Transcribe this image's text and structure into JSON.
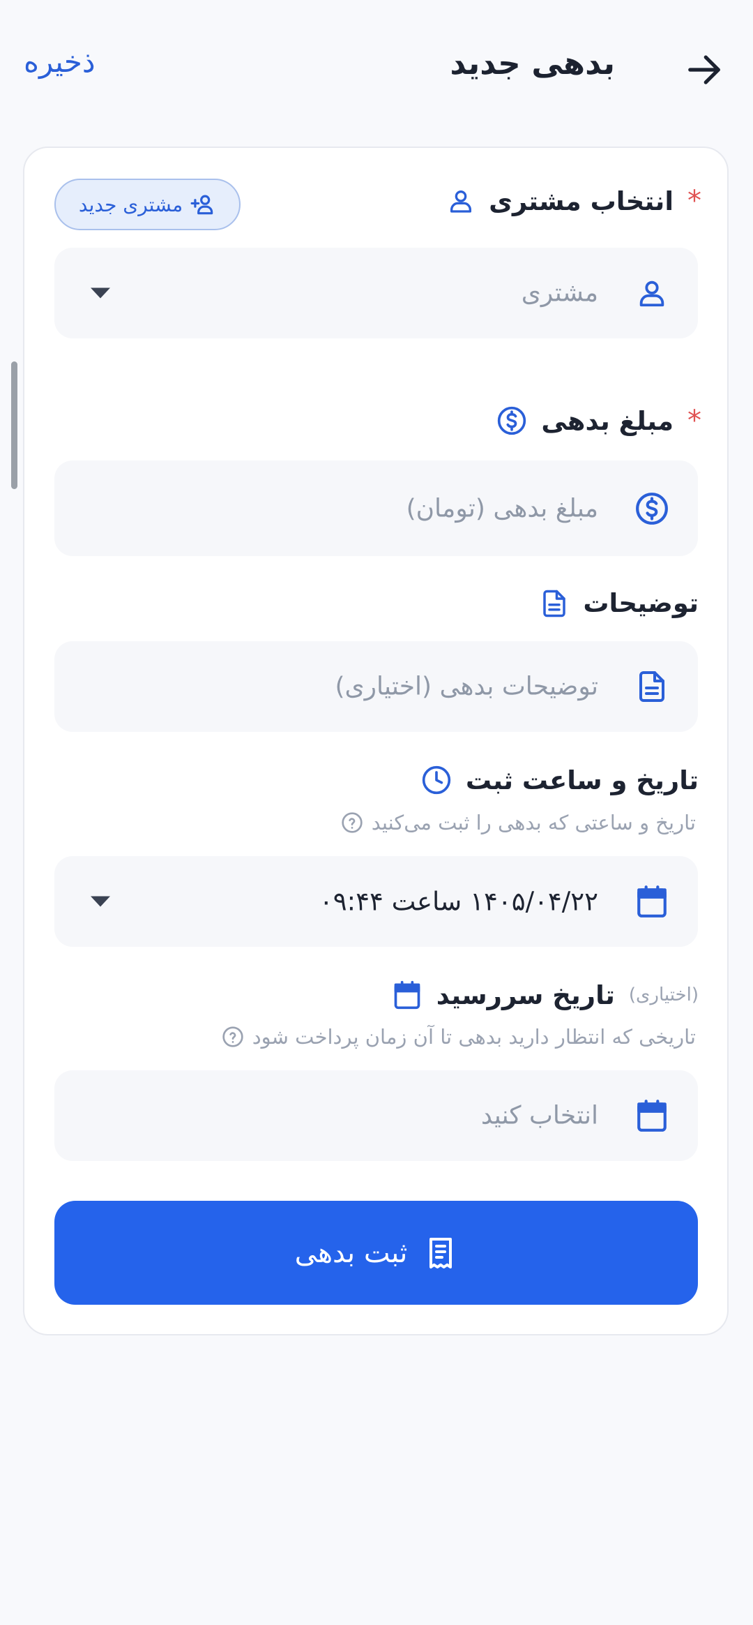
{
  "header": {
    "title": "بدهی جدید",
    "save_label": "ذخیره",
    "back_icon": "arrow-right-icon"
  },
  "customer": {
    "label": "انتخاب مشتری",
    "required_mark": "*",
    "new_customer_label": "مشتری جدید",
    "placeholder": "مشتری"
  },
  "amount": {
    "label": "مبلغ بدهی",
    "required_mark": "*",
    "placeholder": "مبلغ بدهی (تومان)"
  },
  "description": {
    "label": "توضیحات",
    "placeholder": "توضیحات بدهی (اختیاری)"
  },
  "record_date": {
    "label": "تاریخ و ساعت ثبت",
    "hint": "تاریخ و ساعتی که بدهی را ثبت می‌کنید",
    "value": "۱۴۰۵/۰۴/۲۲ ساعت ۰۹:۴۴"
  },
  "due_date": {
    "label": "تاریخ سررسید",
    "optional_note": "(اختیاری)",
    "hint": "تاریخی که انتظار دارید بدهی تا آن زمان پرداخت شود",
    "placeholder": "انتخاب کنید"
  },
  "submit": {
    "label": "ثبت بدهی"
  },
  "colors": {
    "accent": "#2563eb",
    "link": "#2a5fd8",
    "required": "#e05252",
    "background": "#f8f9fc"
  }
}
